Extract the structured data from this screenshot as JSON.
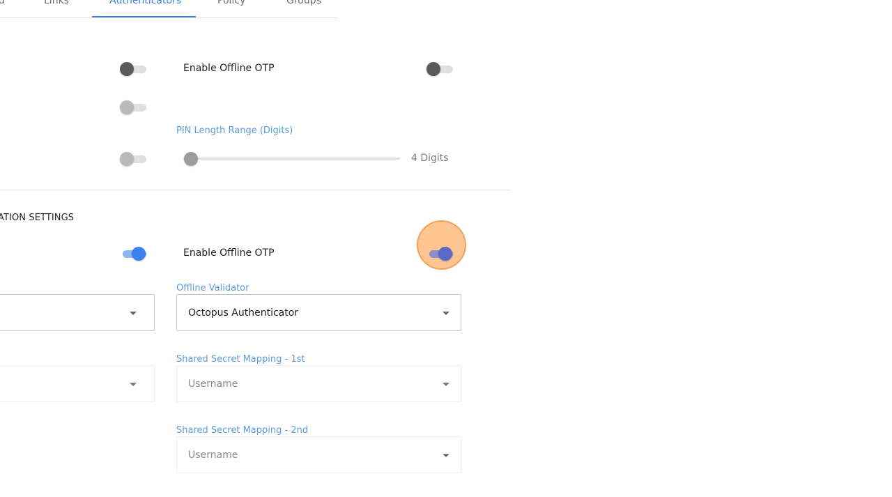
{
  "tabs": [
    {
      "label": "d",
      "active": false
    },
    {
      "label": "Links",
      "active": false
    },
    {
      "label": "Authenticators",
      "active": true
    },
    {
      "label": "Policy",
      "active": false
    },
    {
      "label": "Groups",
      "active": false
    }
  ],
  "offline_top": {
    "enable_label": "Enable Offline OTP",
    "pin_length_label": "PIN Length Range (Digits)",
    "pin_length_value": "4 Digits",
    "left_toggles": [
      false,
      false,
      false
    ],
    "enable_toggle": false
  },
  "section2": {
    "title": "ATION SETTINGS",
    "enable_label": "Enable Offline OTP",
    "left_toggle": true,
    "enable_toggle": true,
    "offline_validator": {
      "label": "Offline Validator",
      "value": "Octopus Authenticator"
    },
    "shared_secret_1": {
      "label": "Shared Secret Mapping - 1st",
      "value": "Username"
    },
    "shared_secret_2": {
      "label": "Shared Secret Mapping - 2nd",
      "value": "Username"
    }
  },
  "icons": {
    "dropdown": "chevron-down-icon"
  },
  "colors": {
    "accent": "#3b82d6",
    "label_blue": "#5b9be0",
    "toggle_on": "#3b82f0",
    "click_marker": "#fcb26e"
  }
}
